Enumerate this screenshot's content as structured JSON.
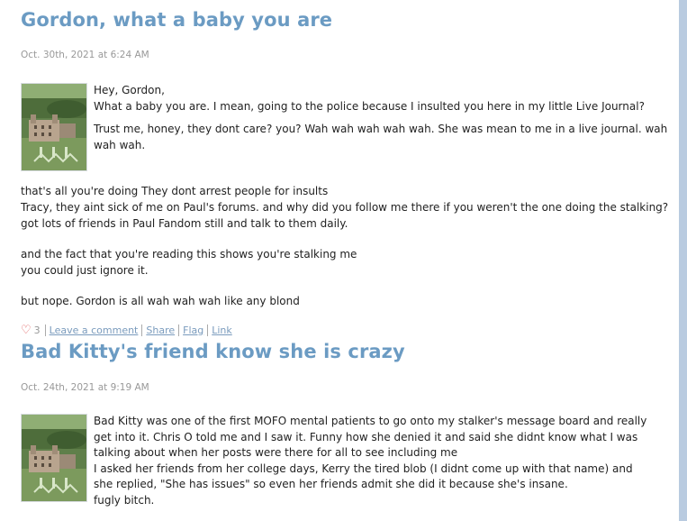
{
  "posts": [
    {
      "title": "Gordon, what a baby you are",
      "date": "Oct. 30th, 2021 at 6:24 AM",
      "paragraphs": [
        "Hey, Gordon,",
        "What a baby you are.  I mean, going to the police because I insulted you here in my little Live Journal?",
        "Trust me, honey, they dont care?  you?  Wah wah wah wah wah.  She was mean to me in a live journal. wah wah wah.",
        "that's all you're doing  They dont arrest people for insults",
        "Tracy, they aint sick of me on Paul's forums.  and why did you follow me there if you weren't the one doing the stalking?",
        "got lots of friends in Paul Fandom still and talk to them daily.",
        "and the fact that you're reading this shows you're stalking me",
        "you could just ignore it.",
        "but nope.  Gordon is all wah wah wah like any blond"
      ],
      "actions": {
        "like_count": "3",
        "comment": "Leave a comment",
        "share": "Share",
        "flag": "Flag",
        "link": "Link"
      }
    },
    {
      "title": "Bad Kitty's friend know she is crazy",
      "date": "Oct. 24th, 2021 at 9:19 AM",
      "paragraphs": [
        "Bad Kitty was one of the first MOFO mental patients to go onto my stalker's message board and really get into it.  Chris O told me and I saw it.  Funny how she denied it and said she didnt know what I was talking about when her posts were there for all to see including me",
        "I asked her friends from her college days, Kerry the tired blob (I didnt come up with that name) and she replied, \"She has issues\"  so even her friends admit she did it because she's insane.",
        "fugly bitch."
      ]
    }
  ],
  "icons": {
    "heart": "heart-icon",
    "thumbnail": "estate-photo"
  }
}
